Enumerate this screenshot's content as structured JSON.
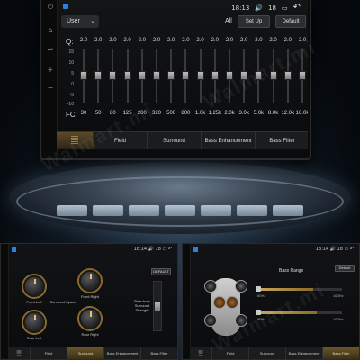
{
  "eq_screen": {
    "preset": "User",
    "all_label": "All",
    "setup_label": "Set Up",
    "default_label": "Default",
    "status_time": "18:13",
    "status_vol": "18",
    "q_label": "Q:",
    "fc_label": "FC",
    "scale": [
      "15",
      "10",
      "5",
      "0",
      "-5",
      "-10"
    ],
    "bands": [
      {
        "q": "2.0",
        "fc": "30",
        "level": 0.5
      },
      {
        "q": "2.0",
        "fc": "50",
        "level": 0.5
      },
      {
        "q": "2.0",
        "fc": "80",
        "level": 0.5
      },
      {
        "q": "2.0",
        "fc": "125",
        "level": 0.5
      },
      {
        "q": "2.0",
        "fc": "200",
        "level": 0.5
      },
      {
        "q": "2.0",
        "fc": "320",
        "level": 0.5
      },
      {
        "q": "2.0",
        "fc": "500",
        "level": 0.5
      },
      {
        "q": "2.0",
        "fc": "800",
        "level": 0.5
      },
      {
        "q": "2.0",
        "fc": "1.0k",
        "level": 0.5
      },
      {
        "q": "2.0",
        "fc": "1.25k",
        "level": 0.5
      },
      {
        "q": "2.0",
        "fc": "2.0k",
        "level": 0.5
      },
      {
        "q": "2.0",
        "fc": "3.0k",
        "level": 0.5
      },
      {
        "q": "2.0",
        "fc": "5.0k",
        "level": 0.5
      },
      {
        "q": "2.0",
        "fc": "8.0k",
        "level": 0.5
      },
      {
        "q": "2.0",
        "fc": "12.0k",
        "level": 0.5
      },
      {
        "q": "2.0",
        "fc": "16.0k",
        "level": 0.5
      }
    ],
    "tabs": [
      "Field",
      "Surround",
      "Bass Enhancement",
      "Bass Filter"
    ]
  },
  "surround_screen": {
    "status_time": "18:14",
    "status_vol": "18",
    "default_label": "DEFAULT",
    "knobs": [
      "Front Left",
      "Front Right",
      "Rear Left",
      "Rear Right"
    ],
    "surround_space": "Surround Space",
    "rear_strength": "Rear from Surround Strength",
    "tabs": [
      "Field",
      "Surround",
      "Bass Enhancement",
      "Bass Filter"
    ],
    "active_tab": "Surround"
  },
  "bass_screen": {
    "status_time": "18:14",
    "status_vol": "18",
    "default_label": "Default",
    "title": "Bass Range",
    "slider1_min": "80Hz",
    "slider1_max": "160Hz",
    "slider2_min": "80Hz",
    "slider2_max": "160Hz",
    "tabs": [
      "Field",
      "Surround",
      "Bass Enhancement",
      "Bass Filter"
    ],
    "active_tab": "Bass Filter"
  },
  "watermark": "Walmart.mi"
}
